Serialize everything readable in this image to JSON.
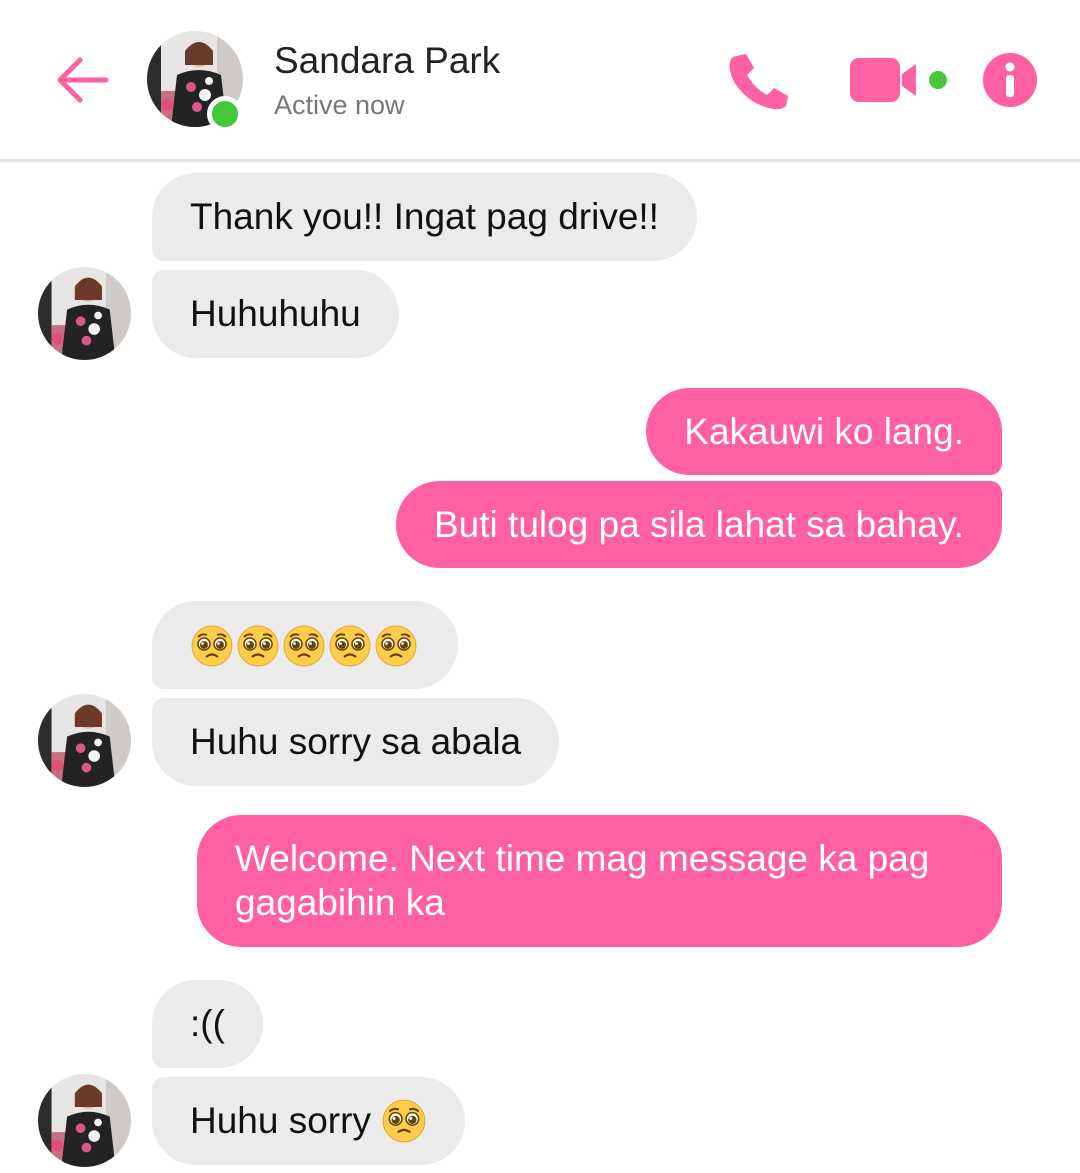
{
  "header": {
    "contact_name": "Sandara Park",
    "status": "Active now",
    "accent_color": "#ff5fa3",
    "online_color": "#44c839",
    "icons": [
      "back-arrow-icon",
      "phone-icon",
      "video-camera-icon",
      "info-icon"
    ]
  },
  "messages": [
    {
      "direction": "in",
      "text": "Thank you!! Ingat pag drive!!"
    },
    {
      "direction": "in",
      "text": "Huhuhuhu"
    },
    {
      "direction": "out",
      "text": "Kakauwi ko lang."
    },
    {
      "direction": "out",
      "text": "Buti tulog pa sila lahat sa bahay."
    },
    {
      "direction": "in",
      "emoji": "pleading-face",
      "count": 5
    },
    {
      "direction": "in",
      "text": "Huhu sorry sa abala"
    },
    {
      "direction": "out",
      "line1": "Welcome. Next time mag message ka pag",
      "line2": "gagabihin ka"
    },
    {
      "direction": "in",
      "text": ":(("
    },
    {
      "direction": "in",
      "text": "Huhu sorry",
      "trailing_emoji": "pleading-face"
    }
  ]
}
